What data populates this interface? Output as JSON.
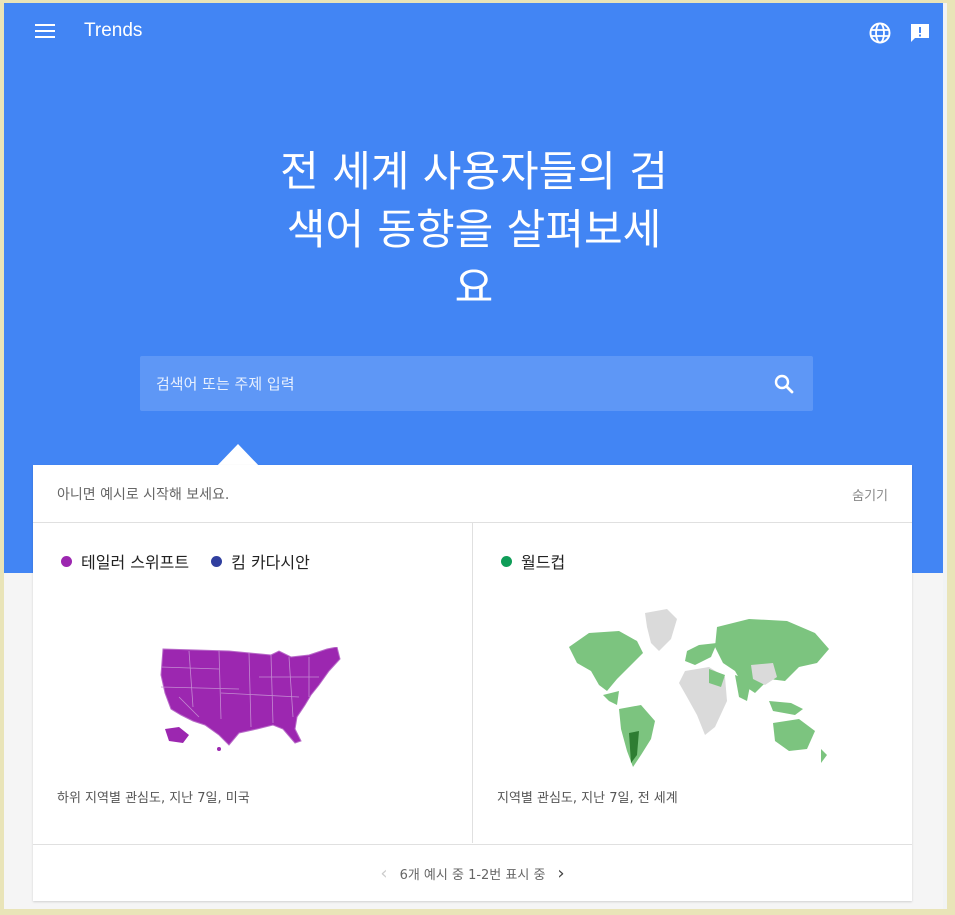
{
  "header": {
    "app_title": "Trends",
    "icons": [
      "menu-icon",
      "globe-icon",
      "feedback-icon"
    ]
  },
  "hero": {
    "headline_lines": [
      "전 세계 사용자들의 검",
      "색어 동향을 살펴보세",
      "요"
    ]
  },
  "search": {
    "placeholder": "검색어 또는 주제 입력",
    "value": "",
    "icon": "search-icon"
  },
  "examples": {
    "intro": "아니면 예시로 시작해 보세요.",
    "hide_label": "숨기기",
    "cards": [
      {
        "terms": [
          {
            "label": "테일러 스위프트",
            "color": "#9c27b0"
          },
          {
            "label": "킴 카다시안",
            "color": "#303f9f"
          }
        ],
        "map": "usa",
        "caption": "하위 지역별 관심도, 지난 7일, 미국"
      },
      {
        "terms": [
          {
            "label": "월드컵",
            "color": "#0f9d58"
          }
        ],
        "map": "world",
        "caption": "지역별 관심도, 지난 7일, 전 세계"
      }
    ],
    "pager": {
      "prev_icon": "chevron-left-icon",
      "text": "6개 예시 중 1-2번 표시 중",
      "next_icon": "chevron-right-icon"
    }
  },
  "colors": {
    "brand_blue": "#4285f4",
    "search_bg": "#5e97f6",
    "usa_fill": "#9c27b0",
    "world_light": "#7cc47f",
    "world_dark": "#2e7d32",
    "world_gray": "#dadada"
  }
}
